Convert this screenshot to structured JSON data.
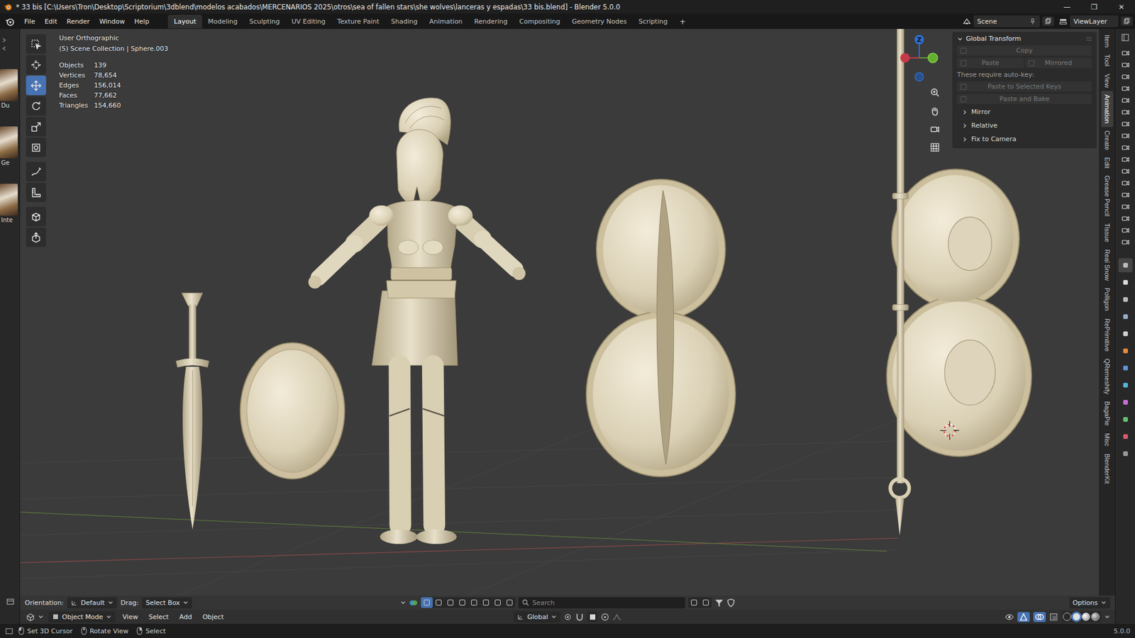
{
  "window": {
    "title": "* 33 bis [C:\\Users\\Tron\\Desktop\\Scriptorium\\3dblend\\modelos acabados\\MERCENARIOS 2025\\otros\\sea of fallen stars\\she wolves\\lanceras y espadas\\33 bis.blend] - Blender 5.0.0",
    "controls": [
      "—",
      "❐",
      "✕"
    ]
  },
  "menus": [
    "File",
    "Edit",
    "Render",
    "Window",
    "Help"
  ],
  "workspaces": [
    {
      "label": "Layout",
      "selected": true
    },
    {
      "label": "Modeling",
      "selected": false
    },
    {
      "label": "Sculpting",
      "selected": false
    },
    {
      "label": "UV Editing",
      "selected": false
    },
    {
      "label": "Texture Paint",
      "selected": false
    },
    {
      "label": "Shading",
      "selected": false
    },
    {
      "label": "Animation",
      "selected": false
    },
    {
      "label": "Rendering",
      "selected": false
    },
    {
      "label": "Compositing",
      "selected": false
    },
    {
      "label": "Geometry Nodes",
      "selected": false
    },
    {
      "label": "Scripting",
      "selected": false
    }
  ],
  "add_workspace": "+",
  "scene": "Scene",
  "view_layer": "ViewLayer",
  "asset_strip": [
    {
      "label": "Du"
    },
    {
      "label": "Ge"
    },
    {
      "label": "Inte"
    }
  ],
  "viewport": {
    "view_name": "User Orthographic",
    "collection": "(5) Scene Collection | Sphere.003",
    "stats": [
      {
        "label": "Objects",
        "value": "139"
      },
      {
        "label": "Vertices",
        "value": "78,654"
      },
      {
        "label": "Edges",
        "value": "156,014"
      },
      {
        "label": "Faces",
        "value": "77,662"
      },
      {
        "label": "Triangles",
        "value": "154,660"
      }
    ],
    "gizmo_axis": "Z"
  },
  "tools": [
    {
      "kind": "select",
      "selected": false
    },
    {
      "kind": "cursor",
      "selected": false
    },
    {
      "kind": "move",
      "selected": true
    },
    {
      "kind": "rotate",
      "selected": false
    },
    {
      "kind": "scale",
      "selected": false
    },
    {
      "kind": "transform",
      "selected": false
    },
    {
      "kind": "annotate",
      "selected": false
    },
    {
      "kind": "measure",
      "selected": false
    },
    {
      "kind": "addcube",
      "selected": false
    },
    {
      "kind": "extrude",
      "selected": false
    }
  ],
  "sidebar_tabs": [
    {
      "label": "Item",
      "selected": false
    },
    {
      "label": "Tool",
      "selected": false
    },
    {
      "label": "View",
      "selected": false
    },
    {
      "label": "Animation",
      "selected": true
    },
    {
      "label": "Create",
      "selected": false
    },
    {
      "label": "Edit",
      "selected": false
    },
    {
      "label": "Grease Pencil",
      "selected": false
    },
    {
      "label": "Tissue",
      "selected": false
    },
    {
      "label": "Real Snow",
      "selected": false
    },
    {
      "label": "Polligon",
      "selected": false
    },
    {
      "label": "RePrimitive",
      "selected": false
    },
    {
      "label": "QRemeshify",
      "selected": false
    },
    {
      "label": "BagaPie",
      "selected": false
    },
    {
      "label": "Misc",
      "selected": false
    },
    {
      "label": "BlenderKit",
      "selected": false
    }
  ],
  "panel": {
    "title": "Global Transform",
    "expanded": true,
    "copy": {
      "label": "Copy",
      "disabled": true
    },
    "paste_row": [
      {
        "label": "Paste",
        "disabled": true
      },
      {
        "label": "Mirrored",
        "disabled": true
      }
    ],
    "note": "These require auto-key:",
    "key_buttons": [
      {
        "label": "Paste to Selected Keys",
        "disabled": true
      },
      {
        "label": "Paste and Bake",
        "disabled": true
      }
    ],
    "subpanels": [
      {
        "label": "Mirror",
        "expanded": false
      },
      {
        "label": "Relative",
        "expanded": false
      },
      {
        "label": "Fix to Camera",
        "expanded": false
      }
    ]
  },
  "tool_settings": {
    "orientation_label": "Orientation:",
    "orientation": "Default",
    "drag_label": "Drag:",
    "drag": "Select Box",
    "search_placeholder": "Search",
    "options": "Options"
  },
  "header": {
    "mode": "Object Mode",
    "menus": [
      "View",
      "Select",
      "Add",
      "Object"
    ],
    "transform_orientation": "Global"
  },
  "status_bar": {
    "items": [
      "Set 3D Cursor",
      "Rotate View",
      "Select"
    ],
    "version": "5.0.0"
  }
}
